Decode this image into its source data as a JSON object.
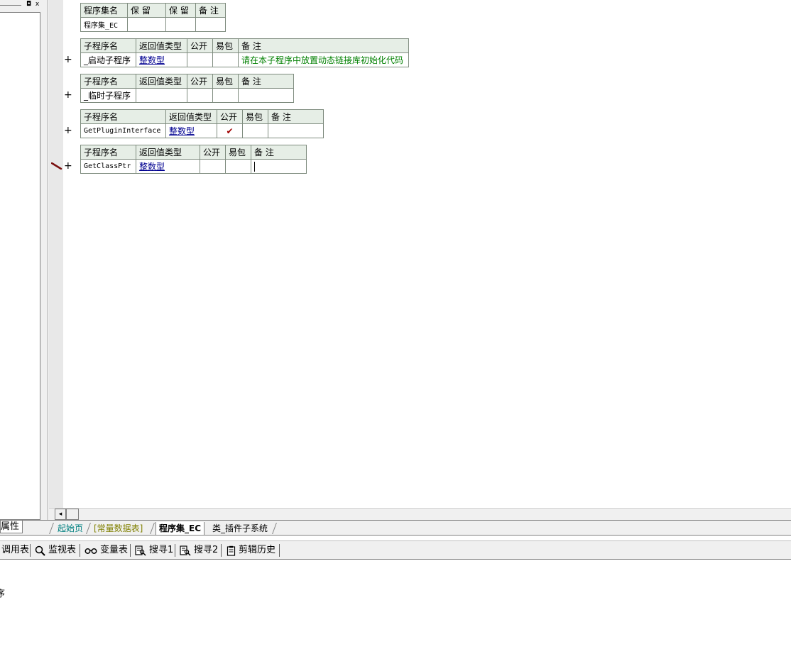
{
  "left_panel": {
    "restore_glyph": "◘",
    "close_glyph": "x"
  },
  "assembly_table": {
    "headers": [
      "程序集名",
      "保 留",
      "保 留",
      "备 注"
    ],
    "row": [
      "程序集_EC",
      "",
      "",
      ""
    ]
  },
  "subroutines": [
    {
      "headers": [
        "子程序名",
        "返回值类型",
        "公开",
        "易包",
        "备 注"
      ],
      "name": "_启动子程序",
      "return_type": "整数型",
      "public": "",
      "easy_pkg": "",
      "note": "请在本子程序中放置动态链接库初始化代码",
      "expand": "+"
    },
    {
      "headers": [
        "子程序名",
        "返回值类型",
        "公开",
        "易包",
        "备 注"
      ],
      "name": "_临时子程序",
      "return_type": "",
      "public": "",
      "easy_pkg": "",
      "note": "",
      "expand": "+"
    },
    {
      "headers": [
        "子程序名",
        "返回值类型",
        "公开",
        "易包",
        "备 注"
      ],
      "name": "GetPluginInterface",
      "return_type": "整数型",
      "public": "✔",
      "easy_pkg": "",
      "note": "",
      "expand": "+"
    },
    {
      "headers": [
        "子程序名",
        "返回值类型",
        "公开",
        "易包",
        "备 注"
      ],
      "name": "GetClassPtr",
      "return_type": "整数型",
      "public": "",
      "easy_pkg": "",
      "note": "",
      "expand": "+"
    }
  ],
  "scrollbar": {
    "left_arrow": "◂"
  },
  "tabs": {
    "properties": "属性",
    "items": [
      "起始页",
      "[常量数据表]",
      "程序集_EC",
      "类_插件子系统"
    ],
    "active_index": 2,
    "colors": {
      "start": "#008080",
      "const": "#808000",
      "active": "#000000"
    }
  },
  "toolbar": {
    "items": [
      {
        "label": "调用表",
        "icon": "call-table-icon"
      },
      {
        "label": "监视表",
        "icon": "magnifier-icon"
      },
      {
        "label": "变量表",
        "icon": "glasses-icon"
      },
      {
        "label": "搜寻1",
        "icon": "search-doc-icon"
      },
      {
        "label": "搜寻2",
        "icon": "search-doc-icon"
      },
      {
        "label": "剪辑历史",
        "icon": "clipboard-icon"
      }
    ]
  },
  "output": {
    "text": "序"
  }
}
